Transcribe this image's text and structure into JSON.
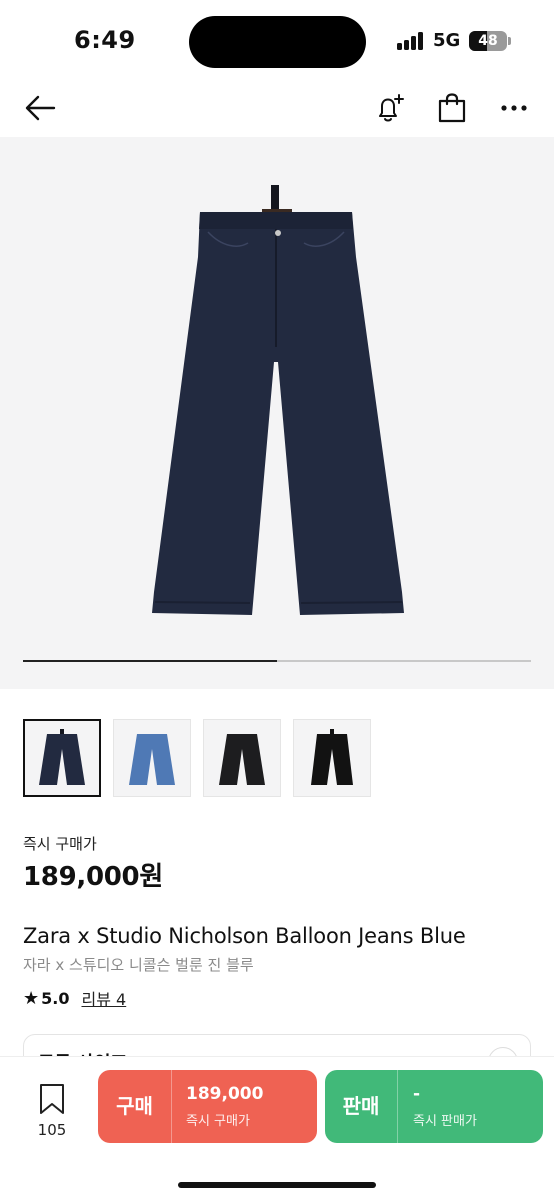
{
  "status_bar": {
    "time": "6:49",
    "network": "5G",
    "battery": "48",
    "battery_level": 0.48
  },
  "gallery": {
    "progress": 0.5,
    "thumbnails": [
      "dark-indigo-jeans",
      "light-blue-jeans",
      "black-jeans",
      "black-jeans-2"
    ]
  },
  "product": {
    "instant_label": "즉시 구매가",
    "price": "189,000원",
    "title_en": "Zara x Studio Nicholson Balloon Jeans Blue",
    "title_ko": "자라 x 스튜디오 니콜슨 벌룬 진 블루",
    "rating": "5.0",
    "reviews": "리뷰 4"
  },
  "size_selector": {
    "label": "모든 사이즈"
  },
  "bottom_bar": {
    "bookmark_count": "105",
    "buy": {
      "label": "구매",
      "price": "189,000",
      "sub": "즉시 구매가",
      "color": "#ef6253"
    },
    "sell": {
      "label": "판매",
      "price": "-",
      "sub": "즉시 판매가",
      "color": "#41b979"
    }
  }
}
